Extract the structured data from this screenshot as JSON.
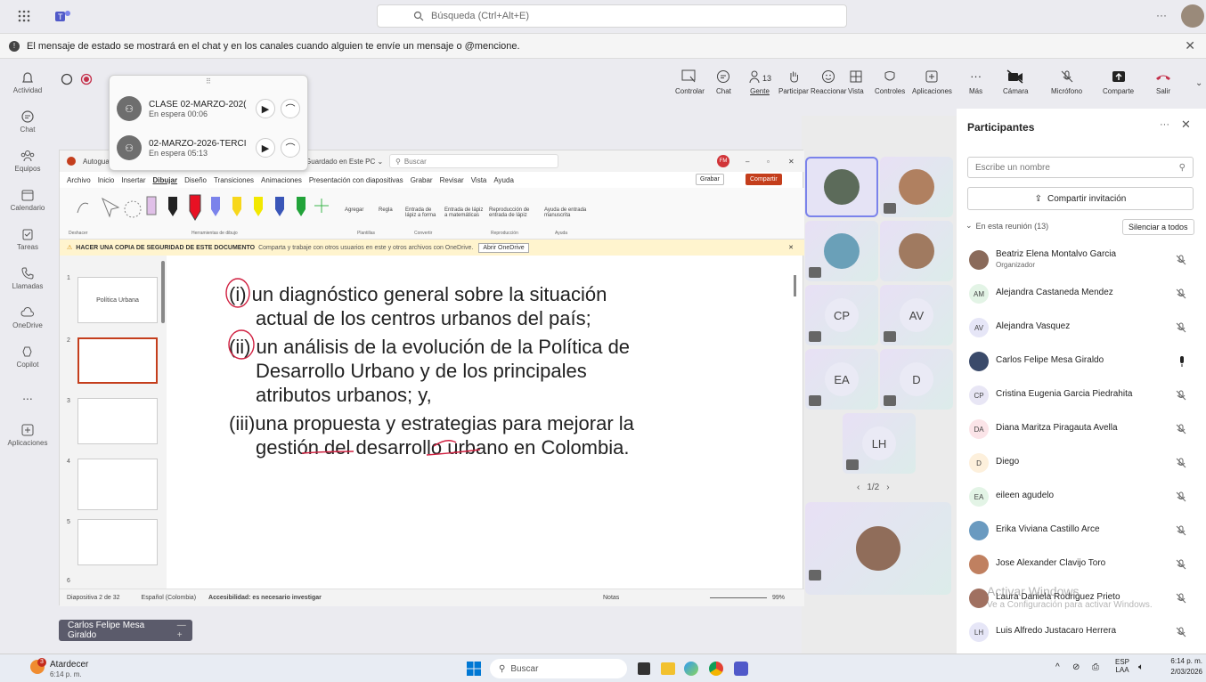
{
  "search": {
    "placeholder": "Búsqueda (Ctrl+Alt+E)"
  },
  "banner": {
    "text": "El mensaje de estado se mostrará en el chat y en los canales cuando alguien te envíe un mensaje o @mencione."
  },
  "rail": [
    {
      "label": "Actividad",
      "icon": "bell-icon"
    },
    {
      "label": "Chat",
      "icon": "chat-icon"
    },
    {
      "label": "Equipos",
      "icon": "teams-icon"
    },
    {
      "label": "Calendario",
      "icon": "calendar-icon"
    },
    {
      "label": "Tareas",
      "icon": "tasks-icon"
    },
    {
      "label": "Llamadas",
      "icon": "phone-icon"
    },
    {
      "label": "OneDrive",
      "icon": "cloud-icon"
    },
    {
      "label": "Copilot",
      "icon": "copilot-icon"
    },
    {
      "label": "...",
      "icon": "more-icon"
    },
    {
      "label": "Aplicaciones",
      "icon": "apps-icon"
    }
  ],
  "toolbar": {
    "people_count": "13",
    "items": [
      "Controlar",
      "Chat",
      "Gente",
      "Participar",
      "Reaccionar",
      "Vista",
      "Controles",
      "Aplicaciones",
      "Más",
      "Cámara",
      "Micrófono",
      "Comparte",
      "Salir"
    ]
  },
  "calls": [
    {
      "title": "CLASE 02-MARZO-202(",
      "status": "En espera  00:06"
    },
    {
      "title": "02-MARZO-2026-TERCI",
      "status": "En espera  05:13"
    }
  ],
  "ppt": {
    "autosave": "Autoguard",
    "saved": "Guardado en Este PC ⌄",
    "search": "Buscar",
    "avatar": "FM",
    "menus": [
      "Archivo",
      "Inicio",
      "Insertar",
      "Dibujar",
      "Diseño",
      "Transiciones",
      "Animaciones",
      "Presentación con diapositivas",
      "Grabar",
      "Revisar",
      "Vista",
      "Ayuda"
    ],
    "grabar": "Grabar",
    "compartir": "Compartir",
    "ribbon_groups": [
      "Deshacer",
      "Herramientas de dibujo",
      "Plantillas",
      "Convertir",
      "Reproducción",
      "Ayuda"
    ],
    "ribbon_labels": [
      "Agregar",
      "Regla",
      "Entrada de lápiz a forma",
      "Entrada de lápiz a matemáticas",
      "Reproducción de entrada de lápiz",
      "Ayuda de entrada manuscrita"
    ],
    "warning": "HACER UNA COPIA DE SEGURIDAD DE ESTE DOCUMENTO",
    "warning_detail": "Comparta y trabaje con otros usuarios en este y otros archivos con OneDrive.",
    "warning_btn": "Abrir OneDrive",
    "thumb1": "Política Urbana",
    "slide_lines": [
      "(i) un diagnóstico general sobre la situación",
      "actual de los centros urbanos del país;",
      "(ii) un análisis de la evolución de la Política de",
      "Desarrollo Urbano y de los principales",
      "atributos urbanos; y,",
      "(iii)una propuesta y estrategias para mejorar la",
      "gestión del desarrollo urbano en Colombia."
    ],
    "status_slide": "Diapositiva 2 de 32",
    "status_lang": "Español (Colombia)",
    "status_access": "Accesibilidad: es necesario investigar",
    "status_notes": "Notas",
    "zoom": "99%"
  },
  "nametag": "Carlos Felipe Mesa Giraldo",
  "grid": {
    "tiles": [
      "CP",
      "AV",
      "EA",
      "D",
      "LH"
    ],
    "pager": "1/2"
  },
  "panel": {
    "title": "Participantes",
    "search_placeholder": "Escribe un nombre",
    "share": "Compartir invitación",
    "section": "En esta reunión (13)",
    "mute_all": "Silenciar a todos",
    "people": [
      {
        "ini": "",
        "name": "Beatriz Elena Montalvo Garcia",
        "role": "Organizador"
      },
      {
        "ini": "AM",
        "name": "Alejandra Castaneda Mendez",
        "role": ""
      },
      {
        "ini": "AV",
        "name": "Alejandra Vasquez",
        "role": ""
      },
      {
        "ini": "",
        "name": "Carlos Felipe Mesa Giraldo",
        "role": ""
      },
      {
        "ini": "CP",
        "name": "Cristina Eugenia Garcia Piedrahita",
        "role": ""
      },
      {
        "ini": "DA",
        "name": "Diana Maritza Piragauta Avella",
        "role": ""
      },
      {
        "ini": "D",
        "name": "Diego",
        "role": ""
      },
      {
        "ini": "EA",
        "name": "eileen agudelo",
        "role": ""
      },
      {
        "ini": "",
        "name": "Erika Viviana Castillo Arce",
        "role": ""
      },
      {
        "ini": "",
        "name": "Jose Alexander Clavijo Toro",
        "role": ""
      },
      {
        "ini": "",
        "name": "Laura Daniela Rodriguez Prieto",
        "role": ""
      },
      {
        "ini": "LH",
        "name": "Luis Alfredo Justacaro Herrera",
        "role": ""
      }
    ],
    "watermark1": "Activar Windows",
    "watermark2": "Ve a Configuración para activar Windows."
  },
  "taskbar": {
    "weather": "Atardecer",
    "weather_time": "6:14 p. m.",
    "weather_badge": "3",
    "search": "Buscar",
    "lang1": "ESP",
    "lang2": "LAA",
    "time": "6:14 p. m.",
    "date": "2/03/2026"
  }
}
